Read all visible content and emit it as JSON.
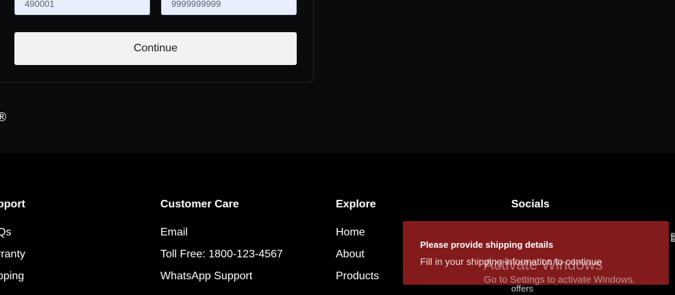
{
  "form": {
    "pincode_value": "490001",
    "phone_value": "9999999999",
    "continue_label": "Continue"
  },
  "copyright_symbol": "®",
  "footer": {
    "support": {
      "title": "pport",
      "items": [
        "Qs",
        "rranty",
        "pping"
      ]
    },
    "customer_care": {
      "title": "Customer Care",
      "items": [
        "Email",
        "Toll Free: 1800-123-4567",
        "WhatsApp Support"
      ]
    },
    "explore": {
      "title": "Explore",
      "items": [
        "Home",
        "About",
        "Products"
      ]
    },
    "socials": {
      "title": "Socials",
      "offers_label": "offers"
    }
  },
  "toast": {
    "title": "Please provide shipping details",
    "message": "Fill in your shipping information to continue",
    "color": "#831b1d"
  },
  "watermark": {
    "title": "Activate Windows",
    "subtitle": "Go to Settings to activate Windows."
  },
  "colors": {
    "page_bg": "#0b0b0d",
    "footer_bg": "#000000",
    "input_bg": "#e8eefb",
    "button_bg": "#f1f2f4"
  }
}
